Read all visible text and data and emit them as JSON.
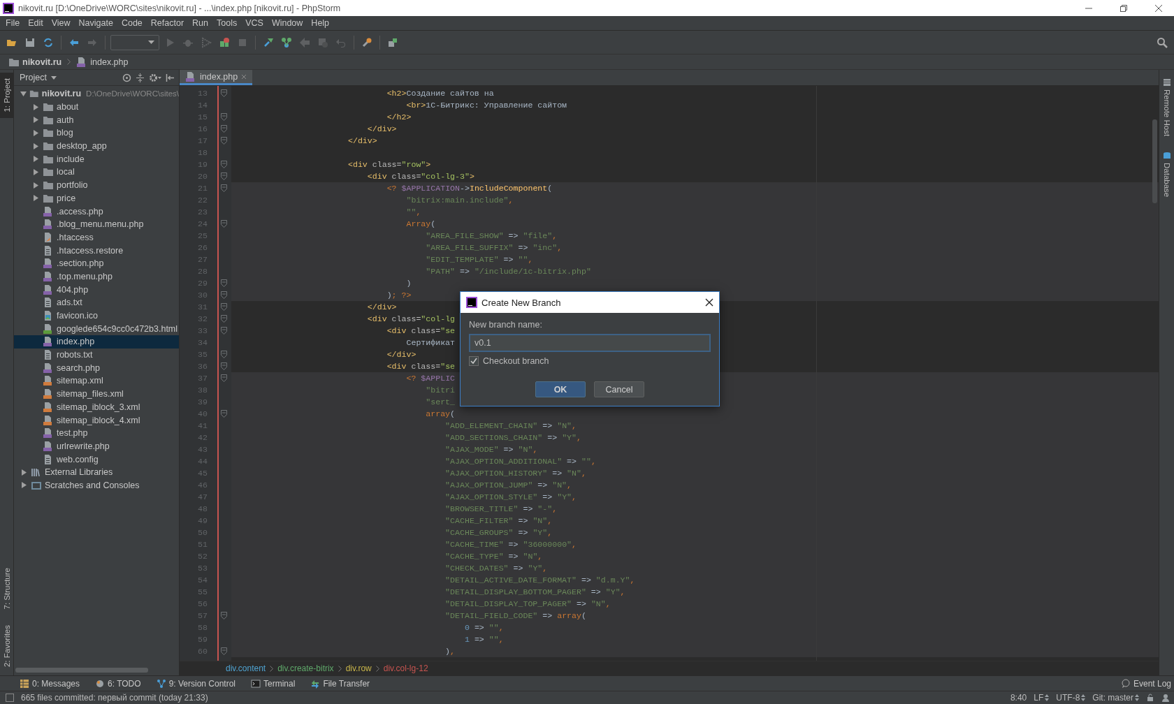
{
  "window": {
    "title": "nikovit.ru [D:\\OneDrive\\WORC\\sites\\nikovit.ru] - ...\\index.php [nikovit.ru] - PhpStorm"
  },
  "menu": [
    "File",
    "Edit",
    "View",
    "Navigate",
    "Code",
    "Refactor",
    "Run",
    "Tools",
    "VCS",
    "Window",
    "Help"
  ],
  "toolbar": [
    {
      "kind": "open",
      "disabled": false
    },
    {
      "kind": "save",
      "disabled": false
    },
    {
      "kind": "sync",
      "disabled": false
    },
    {
      "kind": "separator"
    },
    {
      "kind": "back",
      "disabled": false
    },
    {
      "kind": "forward",
      "disabled": true
    },
    {
      "kind": "separator"
    },
    {
      "kind": "combo"
    },
    {
      "kind": "run",
      "disabled": true
    },
    {
      "kind": "debug",
      "disabled": true
    },
    {
      "kind": "coverage",
      "disabled": true
    },
    {
      "kind": "build-stop",
      "disabled": false
    },
    {
      "kind": "stop",
      "disabled": true
    },
    {
      "kind": "separator"
    },
    {
      "kind": "vcs-update",
      "disabled": false
    },
    {
      "kind": "vcs-commit",
      "disabled": false
    },
    {
      "kind": "compare",
      "disabled": true
    },
    {
      "kind": "history",
      "disabled": true
    },
    {
      "kind": "revert",
      "disabled": true
    },
    {
      "kind": "separator"
    },
    {
      "kind": "settings",
      "disabled": false
    },
    {
      "kind": "separator"
    },
    {
      "kind": "sdk",
      "disabled": false
    }
  ],
  "navbar": [
    {
      "label": "nikovit.ru",
      "kind": "folder"
    },
    {
      "label": "index.php",
      "kind": "php"
    }
  ],
  "left_strip": {
    "top": [
      {
        "label": "1: Project",
        "selected": true
      }
    ],
    "bottom": [
      {
        "label": "7: Structure",
        "selected": false
      },
      {
        "label": "2: Favorites",
        "selected": false
      }
    ]
  },
  "right_strip": [
    {
      "label": "Remote Host",
      "kind": "remote"
    },
    {
      "label": "Database",
      "kind": "database"
    }
  ],
  "project": {
    "title": "Project",
    "tree": [
      {
        "label": "nikovit.ru",
        "path": "D:\\OneDrive\\WORC\\sites\\",
        "kind": "folder",
        "expanded": true,
        "selected": false,
        "children": [
          {
            "label": "about",
            "kind": "folder",
            "expanded": false,
            "selected": false
          },
          {
            "label": "auth",
            "kind": "folder",
            "expanded": false,
            "selected": false
          },
          {
            "label": "blog",
            "kind": "folder",
            "expanded": false,
            "selected": false
          },
          {
            "label": "desktop_app",
            "kind": "folder",
            "expanded": false,
            "selected": false
          },
          {
            "label": "include",
            "kind": "folder",
            "expanded": false,
            "selected": false
          },
          {
            "label": "local",
            "kind": "folder",
            "expanded": false,
            "selected": false
          },
          {
            "label": "portfolio",
            "kind": "folder",
            "expanded": false,
            "selected": false
          },
          {
            "label": "price",
            "kind": "folder",
            "expanded": false,
            "selected": false
          },
          {
            "label": ".access.php",
            "kind": "php",
            "selected": false
          },
          {
            "label": ".blog_menu.menu.php",
            "kind": "php",
            "selected": false
          },
          {
            "label": ".htaccess",
            "kind": "htaccess",
            "selected": false
          },
          {
            "label": ".htaccess.restore",
            "kind": "text",
            "selected": false
          },
          {
            "label": ".section.php",
            "kind": "php",
            "selected": false
          },
          {
            "label": ".top.menu.php",
            "kind": "php",
            "selected": false
          },
          {
            "label": "404.php",
            "kind": "php",
            "selected": false
          },
          {
            "label": "ads.txt",
            "kind": "text",
            "selected": false
          },
          {
            "label": "favicon.ico",
            "kind": "image",
            "selected": false
          },
          {
            "label": "googlede654c9cc0c472b3.html",
            "kind": "html",
            "selected": false
          },
          {
            "label": "index.php",
            "kind": "php",
            "selected": true
          },
          {
            "label": "robots.txt",
            "kind": "text",
            "selected": false
          },
          {
            "label": "search.php",
            "kind": "php",
            "selected": false
          },
          {
            "label": "sitemap.xml",
            "kind": "xml",
            "selected": false
          },
          {
            "label": "sitemap_files.xml",
            "kind": "xml",
            "selected": false
          },
          {
            "label": "sitemap_iblock_3.xml",
            "kind": "xml",
            "selected": false
          },
          {
            "label": "sitemap_iblock_4.xml",
            "kind": "xml",
            "selected": false
          },
          {
            "label": "test.php",
            "kind": "php",
            "selected": false
          },
          {
            "label": "urlrewrite.php",
            "kind": "php",
            "selected": false
          },
          {
            "label": "web.config",
            "kind": "text",
            "selected": false
          }
        ]
      },
      {
        "label": "External Libraries",
        "kind": "library",
        "expanded": false,
        "selected": false
      },
      {
        "label": "Scratches and Consoles",
        "kind": "scratch",
        "expanded": false,
        "selected": false
      }
    ]
  },
  "editor": {
    "tab": {
      "label": "index.php",
      "selected": true
    },
    "lines": [
      {
        "number": "13",
        "fold": true,
        "injected": false,
        "segments": [
          {
            "kind": "tag",
            "text": "                                <h2>"
          },
          {
            "kind": "text",
            "text": "Создание сайтов на"
          }
        ]
      },
      {
        "number": "14",
        "fold": false,
        "injected": false,
        "segments": [
          {
            "kind": "tag",
            "text": "                                    <br>"
          },
          {
            "kind": "text",
            "text": "1С-Битрикс: Управление сайтом"
          }
        ]
      },
      {
        "number": "15",
        "fold": true,
        "injected": false,
        "segments": [
          {
            "kind": "tag",
            "text": "                                </h2>"
          }
        ]
      },
      {
        "number": "16",
        "fold": true,
        "injected": false,
        "segments": [
          {
            "kind": "tag",
            "text": "                            </div>"
          }
        ]
      },
      {
        "number": "17",
        "fold": true,
        "injected": false,
        "segments": [
          {
            "kind": "tag",
            "text": "                        </div>"
          }
        ]
      },
      {
        "number": "18",
        "fold": false,
        "injected": false
      },
      {
        "number": "19",
        "fold": true,
        "injected": false,
        "segments": [
          {
            "kind": "tag",
            "text": "                        <div"
          },
          {
            "kind": "attr",
            "text": " class="
          },
          {
            "kind": "value",
            "text": "\"row\""
          },
          {
            "kind": "tag",
            "text": ">"
          }
        ]
      },
      {
        "number": "20",
        "fold": true,
        "injected": false,
        "segments": [
          {
            "kind": "tag",
            "text": "                            <div"
          },
          {
            "kind": "attr",
            "text": " class="
          },
          {
            "kind": "value",
            "text": "\"col-lg-3\""
          },
          {
            "kind": "tag",
            "text": ">"
          }
        ]
      },
      {
        "number": "21",
        "fold": true,
        "injected": true,
        "segments": [
          {
            "kind": "php",
            "text": "                                <? "
          },
          {
            "kind": "var",
            "text": "$APPLICATION"
          },
          {
            "kind": "text",
            "text": "->"
          },
          {
            "kind": "func",
            "text": "IncludeComponent"
          },
          {
            "kind": "text",
            "text": "("
          }
        ]
      },
      {
        "number": "22",
        "fold": false,
        "injected": true,
        "segments": [
          {
            "kind": "str",
            "text": "                                    \"bitrix:main.include\""
          },
          {
            "kind": "comma",
            "text": ","
          }
        ]
      },
      {
        "number": "23",
        "fold": false,
        "injected": true,
        "segments": [
          {
            "kind": "str",
            "text": "                                    \"\""
          },
          {
            "kind": "comma",
            "text": ","
          }
        ]
      },
      {
        "number": "24",
        "fold": true,
        "injected": true,
        "segments": [
          {
            "kind": "kw",
            "text": "                                    Array"
          },
          {
            "kind": "text",
            "text": "("
          }
        ]
      },
      {
        "number": "25",
        "fold": false,
        "injected": true,
        "segments": [
          {
            "kind": "str",
            "text": "                                        \"AREA_FILE_SHOW\""
          },
          {
            "kind": "text",
            "text": " => "
          },
          {
            "kind": "str",
            "text": "\"file\""
          },
          {
            "kind": "comma",
            "text": ","
          }
        ]
      },
      {
        "number": "26",
        "fold": false,
        "injected": true,
        "segments": [
          {
            "kind": "str",
            "text": "                                        \"AREA_FILE_SUFFIX\""
          },
          {
            "kind": "text",
            "text": " => "
          },
          {
            "kind": "str",
            "text": "\"inc\""
          },
          {
            "kind": "comma",
            "text": ","
          }
        ]
      },
      {
        "number": "27",
        "fold": false,
        "injected": true,
        "segments": [
          {
            "kind": "str",
            "text": "                                        \"EDIT_TEMPLATE\""
          },
          {
            "kind": "text",
            "text": " => "
          },
          {
            "kind": "str",
            "text": "\"\""
          },
          {
            "kind": "comma",
            "text": ","
          }
        ]
      },
      {
        "number": "28",
        "fold": false,
        "injected": true,
        "segments": [
          {
            "kind": "str",
            "text": "                                        \"PATH\""
          },
          {
            "kind": "text",
            "text": " => "
          },
          {
            "kind": "str",
            "text": "\"/include/1c-bitrix.php\""
          }
        ]
      },
      {
        "number": "29",
        "fold": true,
        "injected": true,
        "segments": [
          {
            "kind": "text",
            "text": "                                    )"
          }
        ]
      },
      {
        "number": "30",
        "fold": true,
        "injected": true,
        "segments": [
          {
            "kind": "text",
            "text": "                                )"
          },
          {
            "kind": "comma",
            "text": ";"
          },
          {
            "kind": "php",
            "text": " ?>"
          }
        ]
      },
      {
        "number": "31",
        "fold": true,
        "injected": false,
        "segments": [
          {
            "kind": "tag",
            "text": "                            </div>"
          }
        ]
      },
      {
        "number": "32",
        "fold": true,
        "injected": false,
        "segments": [
          {
            "kind": "tag",
            "text": "                            <div"
          },
          {
            "kind": "attr",
            "text": " class="
          },
          {
            "kind": "value",
            "text": "\"col-lg"
          }
        ]
      },
      {
        "number": "33",
        "fold": true,
        "injected": false,
        "segments": [
          {
            "kind": "tag",
            "text": "                                <div"
          },
          {
            "kind": "attr",
            "text": " class="
          },
          {
            "kind": "value",
            "text": "\"se"
          }
        ]
      },
      {
        "number": "34",
        "fold": false,
        "injected": false,
        "segments": [
          {
            "kind": "text",
            "text": "                                    Сертификат"
          }
        ]
      },
      {
        "number": "35",
        "fold": true,
        "injected": false,
        "segments": [
          {
            "kind": "tag",
            "text": "                                </div>"
          }
        ]
      },
      {
        "number": "36",
        "fold": true,
        "injected": false,
        "segments": [
          {
            "kind": "tag",
            "text": "                                <div"
          },
          {
            "kind": "attr",
            "text": " class="
          },
          {
            "kind": "value",
            "text": "\"se"
          }
        ]
      },
      {
        "number": "37",
        "fold": true,
        "injected": true,
        "segments": [
          {
            "kind": "php",
            "text": "                                    <? "
          },
          {
            "kind": "var",
            "text": "$APPLIC"
          }
        ]
      },
      {
        "number": "38",
        "fold": false,
        "injected": true,
        "segments": [
          {
            "kind": "str",
            "text": "                                        \"bitri"
          }
        ]
      },
      {
        "number": "39",
        "fold": false,
        "injected": true,
        "segments": [
          {
            "kind": "str",
            "text": "                                        \"sert_"
          }
        ]
      },
      {
        "number": "40",
        "fold": true,
        "injected": true,
        "segments": [
          {
            "kind": "kw",
            "text": "                                        array"
          },
          {
            "kind": "text",
            "text": "("
          }
        ]
      },
      {
        "number": "41",
        "fold": false,
        "injected": true,
        "segments": [
          {
            "kind": "str",
            "text": "                                            \"ADD_ELEMENT_CHAIN\""
          },
          {
            "kind": "text",
            "text": " => "
          },
          {
            "kind": "str",
            "text": "\"N\""
          },
          {
            "kind": "comma",
            "text": ","
          }
        ]
      },
      {
        "number": "42",
        "fold": false,
        "injected": true,
        "segments": [
          {
            "kind": "str",
            "text": "                                            \"ADD_SECTIONS_CHAIN\""
          },
          {
            "kind": "text",
            "text": " => "
          },
          {
            "kind": "str",
            "text": "\"Y\""
          },
          {
            "kind": "comma",
            "text": ","
          }
        ]
      },
      {
        "number": "43",
        "fold": false,
        "injected": true,
        "segments": [
          {
            "kind": "str",
            "text": "                                            \"AJAX_MODE\""
          },
          {
            "kind": "text",
            "text": " => "
          },
          {
            "kind": "str",
            "text": "\"N\""
          },
          {
            "kind": "comma",
            "text": ","
          }
        ]
      },
      {
        "number": "44",
        "fold": false,
        "injected": true,
        "segments": [
          {
            "kind": "str",
            "text": "                                            \"AJAX_OPTION_ADDITIONAL\""
          },
          {
            "kind": "text",
            "text": " => "
          },
          {
            "kind": "str",
            "text": "\"\""
          },
          {
            "kind": "comma",
            "text": ","
          }
        ]
      },
      {
        "number": "45",
        "fold": false,
        "injected": true,
        "segments": [
          {
            "kind": "str",
            "text": "                                            \"AJAX_OPTION_HISTORY\""
          },
          {
            "kind": "text",
            "text": " => "
          },
          {
            "kind": "str",
            "text": "\"N\""
          },
          {
            "kind": "comma",
            "text": ","
          }
        ]
      },
      {
        "number": "46",
        "fold": false,
        "injected": true,
        "segments": [
          {
            "kind": "str",
            "text": "                                            \"AJAX_OPTION_JUMP\""
          },
          {
            "kind": "text",
            "text": " => "
          },
          {
            "kind": "str",
            "text": "\"N\""
          },
          {
            "kind": "comma",
            "text": ","
          }
        ]
      },
      {
        "number": "47",
        "fold": false,
        "injected": true,
        "segments": [
          {
            "kind": "str",
            "text": "                                            \"AJAX_OPTION_STYLE\""
          },
          {
            "kind": "text",
            "text": " => "
          },
          {
            "kind": "str",
            "text": "\"Y\""
          },
          {
            "kind": "comma",
            "text": ","
          }
        ]
      },
      {
        "number": "48",
        "fold": false,
        "injected": true,
        "segments": [
          {
            "kind": "str",
            "text": "                                            \"BROWSER_TITLE\""
          },
          {
            "kind": "text",
            "text": " => "
          },
          {
            "kind": "str",
            "text": "\"-\""
          },
          {
            "kind": "comma",
            "text": ","
          }
        ]
      },
      {
        "number": "49",
        "fold": false,
        "injected": true,
        "segments": [
          {
            "kind": "str",
            "text": "                                            \"CACHE_FILTER\""
          },
          {
            "kind": "text",
            "text": " => "
          },
          {
            "kind": "str",
            "text": "\"N\""
          },
          {
            "kind": "comma",
            "text": ","
          }
        ]
      },
      {
        "number": "50",
        "fold": false,
        "injected": true,
        "segments": [
          {
            "kind": "str",
            "text": "                                            \"CACHE_GROUPS\""
          },
          {
            "kind": "text",
            "text": " => "
          },
          {
            "kind": "str",
            "text": "\"Y\""
          },
          {
            "kind": "comma",
            "text": ","
          }
        ]
      },
      {
        "number": "51",
        "fold": false,
        "injected": true,
        "segments": [
          {
            "kind": "str",
            "text": "                                            \"CACHE_TIME\""
          },
          {
            "kind": "text",
            "text": " => "
          },
          {
            "kind": "str",
            "text": "\"36000000\""
          },
          {
            "kind": "comma",
            "text": ","
          }
        ]
      },
      {
        "number": "52",
        "fold": false,
        "injected": true,
        "segments": [
          {
            "kind": "str",
            "text": "                                            \"CACHE_TYPE\""
          },
          {
            "kind": "text",
            "text": " => "
          },
          {
            "kind": "str",
            "text": "\"N\""
          },
          {
            "kind": "comma",
            "text": ","
          }
        ]
      },
      {
        "number": "53",
        "fold": false,
        "injected": true,
        "segments": [
          {
            "kind": "str",
            "text": "                                            \"CHECK_DATES\""
          },
          {
            "kind": "text",
            "text": " => "
          },
          {
            "kind": "str",
            "text": "\"Y\""
          },
          {
            "kind": "comma",
            "text": ","
          }
        ]
      },
      {
        "number": "54",
        "fold": false,
        "injected": true,
        "segments": [
          {
            "kind": "str",
            "text": "                                            \"DETAIL_ACTIVE_DATE_FORMAT\""
          },
          {
            "kind": "text",
            "text": " => "
          },
          {
            "kind": "str",
            "text": "\"d.m.Y\""
          },
          {
            "kind": "comma",
            "text": ","
          }
        ]
      },
      {
        "number": "55",
        "fold": false,
        "injected": true,
        "segments": [
          {
            "kind": "str",
            "text": "                                            \"DETAIL_DISPLAY_BOTTOM_PAGER\""
          },
          {
            "kind": "text",
            "text": " => "
          },
          {
            "kind": "str",
            "text": "\"Y\""
          },
          {
            "kind": "comma",
            "text": ","
          }
        ]
      },
      {
        "number": "56",
        "fold": false,
        "injected": true,
        "segments": [
          {
            "kind": "str",
            "text": "                                            \"DETAIL_DISPLAY_TOP_PAGER\""
          },
          {
            "kind": "text",
            "text": " => "
          },
          {
            "kind": "str",
            "text": "\"N\""
          },
          {
            "kind": "comma",
            "text": ","
          }
        ]
      },
      {
        "number": "57",
        "fold": true,
        "injected": true,
        "segments": [
          {
            "kind": "str",
            "text": "                                            \"DETAIL_FIELD_CODE\""
          },
          {
            "kind": "text",
            "text": " => "
          },
          {
            "kind": "kw",
            "text": "array"
          },
          {
            "kind": "text",
            "text": "("
          }
        ]
      },
      {
        "number": "58",
        "fold": false,
        "injected": true,
        "segments": [
          {
            "kind": "num",
            "text": "                                                0"
          },
          {
            "kind": "text",
            "text": " => "
          },
          {
            "kind": "str",
            "text": "\"\""
          },
          {
            "kind": "comma",
            "text": ","
          }
        ]
      },
      {
        "number": "59",
        "fold": false,
        "injected": true,
        "segments": [
          {
            "kind": "num",
            "text": "                                                1"
          },
          {
            "kind": "text",
            "text": " => "
          },
          {
            "kind": "str",
            "text": "\"\""
          },
          {
            "kind": "comma",
            "text": ","
          }
        ]
      },
      {
        "number": "60",
        "fold": true,
        "injected": true,
        "segments": [
          {
            "kind": "text",
            "text": "                                            )"
          },
          {
            "kind": "comma",
            "text": ","
          }
        ]
      }
    ],
    "breadcrumbs": [
      {
        "label": "div.content",
        "color": "#4fa3d1"
      },
      {
        "label": "div.create-bitrix",
        "color": "#5fa86a"
      },
      {
        "label": "div.row",
        "color": "#c9b64a"
      },
      {
        "label": "div.col-lg-12",
        "color": "#c75450"
      }
    ]
  },
  "dialog": {
    "title": "Create New Branch",
    "label": "New branch name:",
    "value": "v0.1",
    "checkbox": {
      "label": "Checkout branch",
      "checked": true
    },
    "buttons": [
      {
        "label": "OK",
        "kind": "primary"
      },
      {
        "label": "Cancel",
        "kind": "secondary"
      }
    ]
  },
  "tool_tabs": [
    {
      "label": "0: Messages",
      "kind": "messages"
    },
    {
      "label": "6: TODO",
      "kind": "todo"
    },
    {
      "label": "9: Version Control",
      "kind": "vcs"
    },
    {
      "label": "Terminal",
      "kind": "terminal"
    },
    {
      "label": "File Transfer",
      "kind": "transfer"
    }
  ],
  "event_log": {
    "label": "Event Log"
  },
  "status_bar": {
    "message": "665 files committed: первый commit (today 21:33)",
    "items": [
      {
        "label": "8:40",
        "kind": "plain"
      },
      {
        "label": "LF",
        "kind": "select"
      },
      {
        "label": "UTF-8",
        "kind": "select"
      },
      {
        "label": "Git: master",
        "kind": "select"
      }
    ]
  }
}
